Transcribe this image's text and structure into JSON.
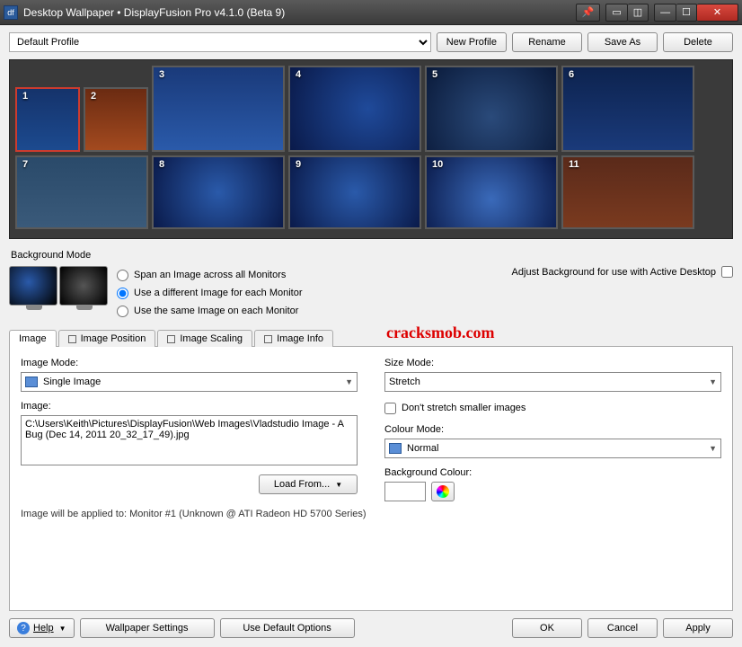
{
  "window": {
    "title": "Desktop Wallpaper • DisplayFusion Pro v4.1.0 (Beta 9)"
  },
  "toolbar": {
    "profile_selected": "Default Profile",
    "new_profile": "New Profile",
    "rename": "Rename",
    "save_as": "Save As",
    "delete": "Delete"
  },
  "monitors": [
    {
      "n": "1"
    },
    {
      "n": "2"
    },
    {
      "n": "3"
    },
    {
      "n": "4"
    },
    {
      "n": "5"
    },
    {
      "n": "6"
    },
    {
      "n": "7"
    },
    {
      "n": "8"
    },
    {
      "n": "9"
    },
    {
      "n": "10"
    },
    {
      "n": "11"
    }
  ],
  "bgmode": {
    "heading": "Background Mode",
    "opt_span": "Span an Image across all Monitors",
    "opt_diff": "Use a different Image for each Monitor",
    "opt_same": "Use the same Image on each Monitor",
    "adjust_label": "Adjust Background for use with Active Desktop"
  },
  "watermark": "cracksmob.com",
  "tabs": {
    "image": "Image",
    "position": "Image Position",
    "scaling": "Image Scaling",
    "info": "Image Info"
  },
  "panel": {
    "image_mode_label": "Image Mode:",
    "image_mode_value": "Single Image",
    "image_label": "Image:",
    "image_path": "C:\\Users\\Keith\\Pictures\\DisplayFusion\\Web Images\\Vladstudio Image - A Bug (Dec 14, 2011 20_32_17_49).jpg",
    "load_from": "Load From...",
    "size_mode_label": "Size Mode:",
    "size_mode_value": "Stretch",
    "dont_stretch": "Don't stretch smaller images",
    "colour_mode_label": "Colour Mode:",
    "colour_mode_value": "Normal",
    "bg_colour_label": "Background Colour:",
    "applied_to": "Image will be applied to: Monitor #1 (Unknown @ ATI Radeon HD 5700 Series)"
  },
  "footer": {
    "help": "Help",
    "wallpaper_settings": "Wallpaper Settings",
    "use_defaults": "Use Default Options",
    "ok": "OK",
    "cancel": "Cancel",
    "apply": "Apply"
  }
}
